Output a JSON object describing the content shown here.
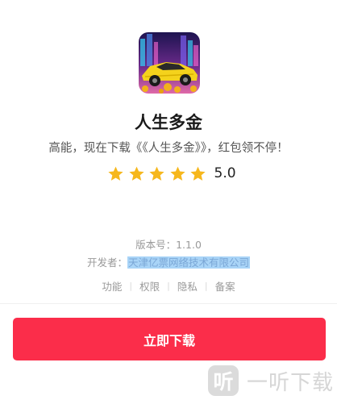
{
  "app": {
    "name": "人生多金",
    "tagline": "高能，现在下载《《人生多金》》，红包领不停！",
    "icon": "yellow-sports-car-icon"
  },
  "rating": {
    "value": "5.0",
    "stars": 5,
    "star_color": "#f6b71c"
  },
  "info": {
    "version_label": "版本号：1.1.0",
    "developer_label": "开发者：",
    "developer_name": "天津亿票网络技术有限公司"
  },
  "links": [
    {
      "label": "功能"
    },
    {
      "label": "权限"
    },
    {
      "label": "隐私"
    },
    {
      "label": "备案"
    }
  ],
  "download": {
    "label": "立即下载",
    "color": "#fb2d4a"
  },
  "watermark": {
    "logo_char": "听",
    "text": "一听下载"
  }
}
